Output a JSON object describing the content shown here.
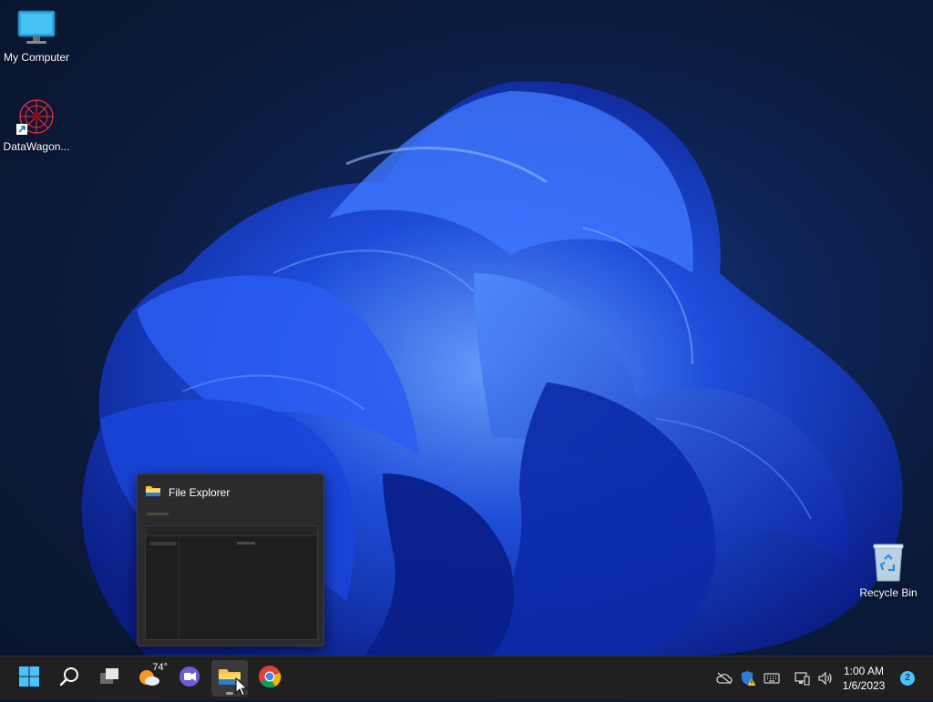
{
  "desktop": {
    "icons": [
      {
        "label": "My Computer",
        "icon": "monitor-icon"
      },
      {
        "label": "DataWagon...",
        "icon": "datawagon-shortcut-icon"
      },
      {
        "label": "Recycle Bin",
        "icon": "recycle-bin-icon"
      }
    ]
  },
  "preview": {
    "title": "File Explorer",
    "icon": "folder-icon"
  },
  "taskbar": {
    "items": [
      {
        "name": "start",
        "icon": "windows-logo-icon"
      },
      {
        "name": "search",
        "icon": "search-icon"
      },
      {
        "name": "task-view",
        "icon": "task-view-icon"
      },
      {
        "name": "weather",
        "icon": "weather-icon",
        "temp": "74°"
      },
      {
        "name": "teams-chat",
        "icon": "chat-icon"
      },
      {
        "name": "file-explorer",
        "icon": "folder-icon",
        "active": true
      },
      {
        "name": "chrome",
        "icon": "chrome-icon"
      }
    ],
    "tray": {
      "icons": [
        "onedrive-icon",
        "security-warning-icon",
        "keyboard-icon",
        "network-icon",
        "volume-icon"
      ],
      "time": "1:00 AM",
      "date": "1/6/2023",
      "notifications": "2"
    }
  },
  "colors": {
    "taskbar": "#202020",
    "accent": "#4cc2ff",
    "bloom": "#1f4fe0"
  }
}
